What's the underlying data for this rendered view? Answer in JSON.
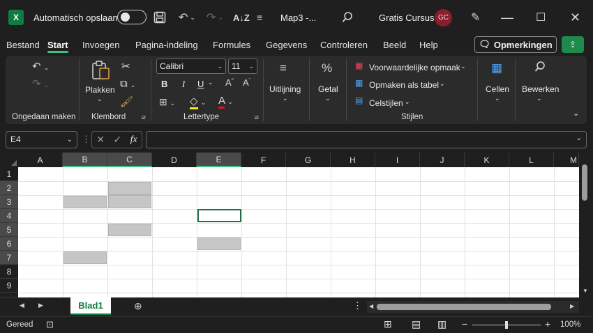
{
  "titlebar": {
    "logo": "X",
    "autosave_label": "Automatisch opslaan",
    "filename": "Map3  -...",
    "account_name": "Gratis Cursus",
    "avatar_initials": "GC"
  },
  "menu": {
    "tabs": [
      "Bestand",
      "Start",
      "Invoegen",
      "Pagina-indeling",
      "Formules",
      "Gegevens",
      "Controleren",
      "Beeld",
      "Help"
    ],
    "comments_label": "Opmerkingen"
  },
  "ribbon": {
    "groups": {
      "undo": "Ongedaan maken",
      "clipboard": "Klembord",
      "font": "Lettertype",
      "styles": "Stijlen"
    },
    "paste_label": "Plakken",
    "font_name": "Calibri",
    "font_size": "11",
    "alignment_label": "Uitlijning",
    "number_label": "Getal",
    "percent_symbol": "%",
    "conditional_label": "Voorwaardelijke opmaak",
    "format_table_label": "Opmaken als tabel",
    "cell_styles_label": "Celstijlen",
    "cells_label": "Cellen",
    "editing_label": "Bewerken",
    "bold": "B",
    "italic": "I",
    "underline": "U"
  },
  "formula_bar": {
    "name_box": "E4",
    "fx": "fx",
    "formula": ""
  },
  "grid": {
    "columns": [
      "A",
      "B",
      "C",
      "D",
      "E",
      "F",
      "G",
      "H",
      "I",
      "J",
      "K",
      "L",
      "M"
    ],
    "rows": [
      "1",
      "2",
      "3",
      "4",
      "5",
      "6",
      "7",
      "8",
      "9"
    ],
    "active_cell": "E4",
    "shaded_cells": [
      "C2",
      "B3",
      "C3",
      "C5",
      "E6",
      "B7"
    ]
  },
  "sheets": {
    "tabs": [
      "Blad1"
    ]
  },
  "statusbar": {
    "status": "Gereed",
    "zoom": "100%"
  },
  "colors": {
    "accent": "#107c41",
    "active_tab_underline": "#3fbf7f",
    "shaded_cell": "#c6c6c6"
  }
}
